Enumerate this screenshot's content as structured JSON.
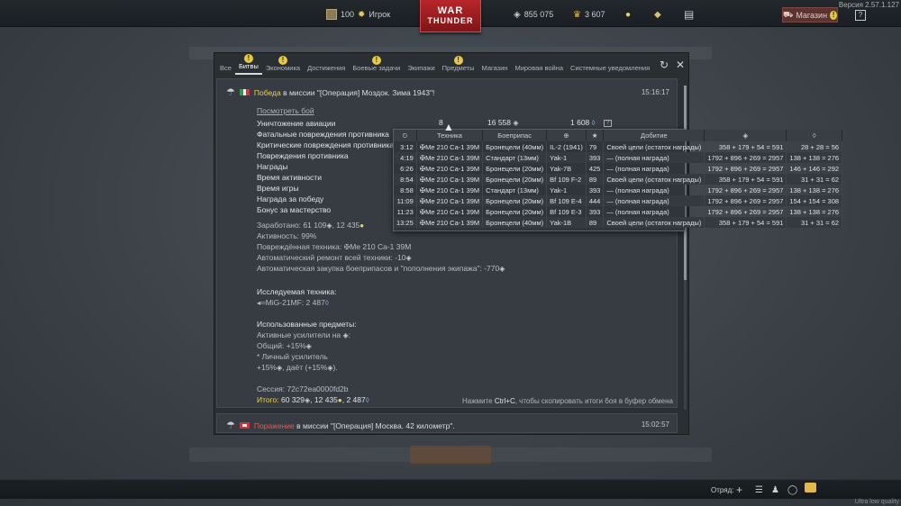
{
  "topbar": {
    "player_level": "100",
    "player_name": "Игрок",
    "silver_lions": "855 075",
    "golden_eagles": "3 607",
    "logo_line1": "WAR",
    "logo_line2": "THUNDER",
    "shop_label": "Магазин",
    "help_label": "?",
    "version": "Версия 2.57.1.127"
  },
  "tabs": [
    {
      "label": "Все",
      "warn": false
    },
    {
      "label": "Битвы",
      "warn": true,
      "active": true
    },
    {
      "label": "Экономика",
      "warn": true
    },
    {
      "label": "Достижения",
      "warn": false
    },
    {
      "label": "Боевые задачи",
      "warn": true
    },
    {
      "label": "Экипажи",
      "warn": false
    },
    {
      "label": "Предметы",
      "warn": true
    },
    {
      "label": "Магазин",
      "warn": false
    },
    {
      "label": "Мировая война",
      "warn": false
    },
    {
      "label": "Системные уведомления",
      "warn": false
    }
  ],
  "card": {
    "result": "Победа",
    "mission_text": " в миссии \"[Операция] Моздок. Зима 1943\"!",
    "time": "15:16:17",
    "view_battle": "Посмотреть бой",
    "reward_rows": [
      "Уничтожение авиации",
      "Фатальные повреждения противника",
      "Критические повреждения противника",
      "Повреждения противника",
      "Награды",
      "Время активности",
      "Время игры",
      "Награда за победу",
      "Бонус за мастерство"
    ],
    "aviation_count": "8",
    "aviation_silver": "16 558",
    "aviation_rp": "1 608",
    "earned": "Заработано: 61 109",
    "earned_rp": ", 12 435",
    "activity": "Активность: 99%",
    "damaged_vehicle": "Повреждённая техника: ",
    "damaged_vehicle_name": "Me 210 Ca-1 39M",
    "auto_repair": "Автоматический ремонт всей техники: -10",
    "auto_purchase": "Автоматическая закупка боеприпасов и \"пополнения экипажа\": -770",
    "research_title": "Исследуемая техника:",
    "research_item": "MiG-21MF: 2 487",
    "used_items_title": "Использованные предметы:",
    "active_boosters": "Активные усилители на ",
    "general": "Общий: +15%",
    "personal": "* Личный усилитель",
    "personal_val": "+15%",
    "personal_give": ", даёт (+15%",
    "session": "Сессия: 72c72ea0000fd2b",
    "total_label": "Итого:",
    "total_value": " 60 329",
    "total_rp": ", 12 435",
    "total_rp2": ", 2 487",
    "hint_pre": "Нажмите ",
    "hint_key": "Ctrl+C",
    "hint_post": ", чтобы скопировать итоги боя в буфер обмена"
  },
  "tooltip": {
    "headers": [
      "⏲",
      "Техника",
      "Боеприпас",
      "⊕",
      "★",
      "Добитие",
      "◈",
      "◊"
    ],
    "rows": [
      [
        "3:12",
        "Me 210 Ca-1 39M",
        "Бронецели (40мм)",
        "IL-2 (1941)",
        "79",
        "Своей цели (остаток награды)",
        "358 + 179 + 54 = 591",
        "28 + 28 = 56"
      ],
      [
        "4:19",
        "Me 210 Ca-1 39M",
        "Стандарт (13мм)",
        "Yak-1",
        "393",
        "— (полная награда)",
        "1792 + 896 + 269 = 2957",
        "138 + 138 = 276"
      ],
      [
        "6:26",
        "Me 210 Ca-1 39M",
        "Бронецели (20мм)",
        "Yak-7B",
        "425",
        "— (полная награда)",
        "1792 + 896 + 269 = 2957",
        "146 + 146 = 292"
      ],
      [
        "8:54",
        "Me 210 Ca-1 39M",
        "Бронецели (20мм)",
        "Bf 109 F-2",
        "89",
        "Своей цели (остаток награды)",
        "358 + 179 + 54 = 591",
        "31 + 31 = 62"
      ],
      [
        "8:58",
        "Me 210 Ca-1 39M",
        "Стандарт (13мм)",
        "Yak-1",
        "393",
        "— (полная награда)",
        "1792 + 896 + 269 = 2957",
        "138 + 138 = 276"
      ],
      [
        "11:09",
        "Me 210 Ca-1 39M",
        "Бронецели (20мм)",
        "Bf 109 E-4",
        "444",
        "— (полная награда)",
        "1792 + 896 + 269 = 2957",
        "154 + 154 = 308"
      ],
      [
        "11:23",
        "Me 210 Ca-1 39M",
        "Бронецели (20мм)",
        "Bf 109 E-3",
        "393",
        "— (полная награда)",
        "1792 + 896 + 269 = 2957",
        "138 + 138 = 276"
      ],
      [
        "13:25",
        "Me 210 Ca-1 39M",
        "Бронецели (40мм)",
        "Yak-1B",
        "89",
        "Своей цели (остаток награды)",
        "358 + 179 + 54 = 591",
        "31 + 31 = 62"
      ]
    ]
  },
  "card2": {
    "result": "Поражение",
    "mission_text": " в миссии \"[Операция] Москва. 42 километр\".",
    "time": "15:02:57"
  },
  "bottombar": {
    "squad_label": "Отряд:",
    "quality": "Ultra low quality"
  },
  "colors": {
    "victory": "#e9cf5a",
    "defeat": "#e25b57",
    "warning": "#e8c943"
  }
}
